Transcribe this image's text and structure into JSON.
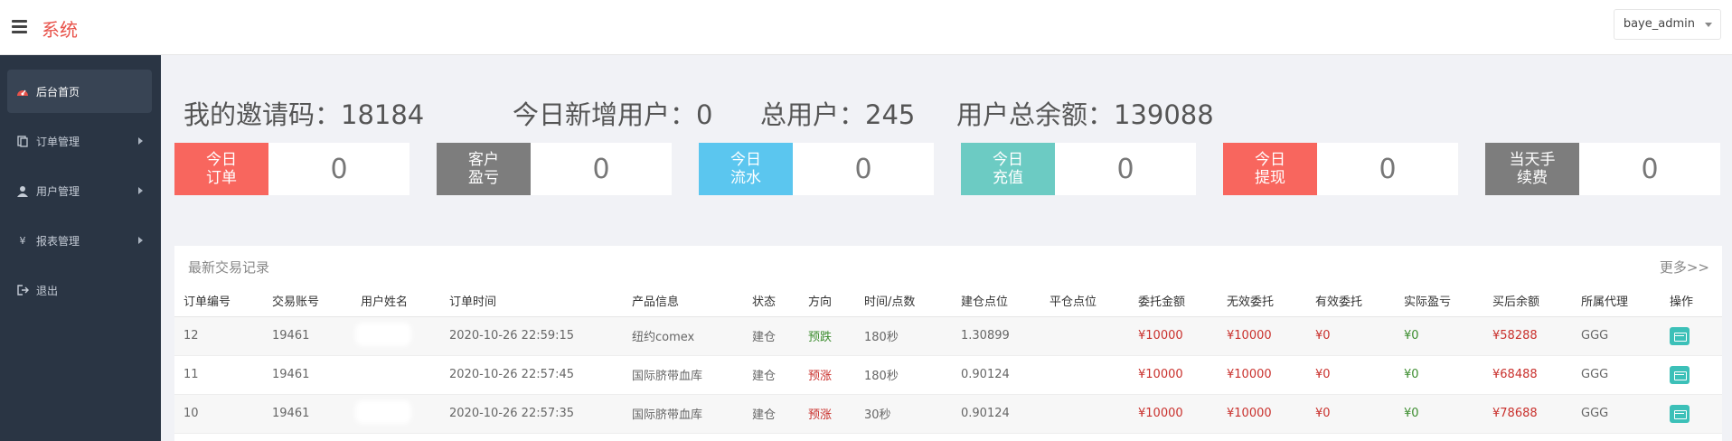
{
  "header": {
    "brand": "系统",
    "user": "baye_admin"
  },
  "sidebar": {
    "items": [
      {
        "label": "后台首页",
        "icon": "dashboard-icon",
        "active": true
      },
      {
        "label": "订单管理",
        "icon": "clipboard-icon"
      },
      {
        "label": "用户管理",
        "icon": "user-icon"
      },
      {
        "label": "报表管理",
        "icon": "yen-icon"
      },
      {
        "label": "退出",
        "icon": "logout-icon"
      }
    ]
  },
  "stats": {
    "invite": "我的邀请码：18184",
    "new_users": "今日新增用户：0",
    "total_users": "总用户：245",
    "total_balance": "用户总余额：139088"
  },
  "cards": [
    {
      "label": "今日订单",
      "value": "0",
      "color": "#f8665e"
    },
    {
      "label": "客户盈亏",
      "value": "0",
      "color": "#7d7d7d"
    },
    {
      "label": "今日流水",
      "value": "0",
      "color": "#5bc6ef"
    },
    {
      "label": "今日充值",
      "value": "0",
      "color": "#6ccbc3"
    },
    {
      "label": "今日提现",
      "value": "0",
      "color": "#f8665e"
    },
    {
      "label": "当天手续费",
      "value": "0",
      "color": "#7d7d7d"
    }
  ],
  "panel": {
    "title": "最新交易记录",
    "more": "更多>>",
    "columns": [
      "订单编号",
      "交易账号",
      "用户姓名",
      "订单时间",
      "产品信息",
      "状态",
      "方向",
      "时间/点数",
      "建仓点位",
      "平仓点位",
      "委托金额",
      "无效委托",
      "有效委托",
      "实际盈亏",
      "买后余额",
      "所属代理",
      "操作"
    ],
    "rows": [
      {
        "id": "12",
        "account": "19461",
        "name": "",
        "time": "2020-10-26 22:59:15",
        "product": "纽约comex",
        "status": "建仓",
        "direction": "预跌",
        "dir_color": "green",
        "duration": "180秒",
        "open": "1.30899",
        "close": "",
        "amount": "¥10000",
        "invalid": "¥10000",
        "valid": "¥0",
        "pnl": "¥0",
        "balance": "¥58288",
        "agent": "GGG"
      },
      {
        "id": "11",
        "account": "19461",
        "name": "",
        "time": "2020-10-26 22:57:45",
        "product": "国际脐带血库",
        "status": "建仓",
        "direction": "预涨",
        "dir_color": "red",
        "duration": "180秒",
        "open": "0.90124",
        "close": "",
        "amount": "¥10000",
        "invalid": "¥10000",
        "valid": "¥0",
        "pnl": "¥0",
        "balance": "¥68488",
        "agent": "GGG"
      },
      {
        "id": "10",
        "account": "19461",
        "name": "",
        "time": "2020-10-26 22:57:35",
        "product": "国际脐带血库",
        "status": "建仓",
        "direction": "预涨",
        "dir_color": "red",
        "duration": "30秒",
        "open": "0.90124",
        "close": "",
        "amount": "¥10000",
        "invalid": "¥10000",
        "valid": "¥0",
        "pnl": "¥0",
        "balance": "¥78688",
        "agent": "GGG"
      }
    ]
  }
}
